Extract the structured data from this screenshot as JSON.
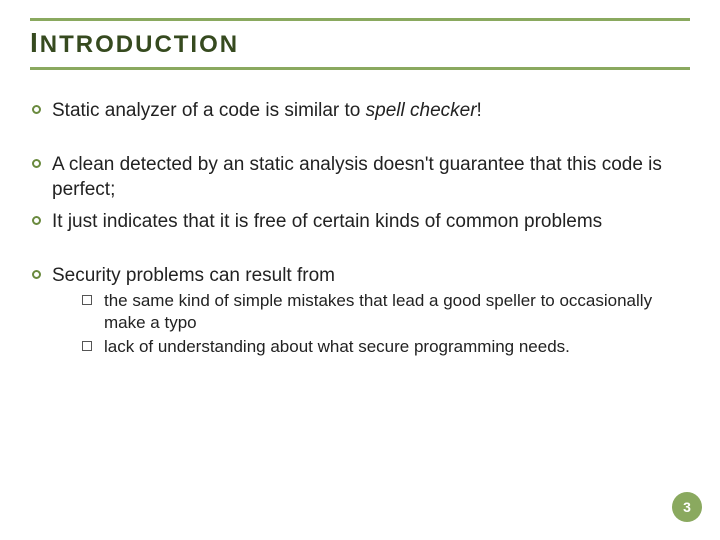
{
  "title_word": "NTRODUCTION",
  "title_cap": "I",
  "bullets": {
    "b1_pre": "Static analyzer of a code is similar to ",
    "b1_italic": "spell checker",
    "b1_post": "!",
    "b2": "A clean detected by an static analysis doesn't guarantee that this code is perfect;",
    "b3": "It just indicates that it is free of certain kinds of common problems",
    "b4": "Security problems can result from",
    "sub1": "the same kind of simple mistakes that lead a good speller to occasionally make a typo",
    "sub2": "lack of understanding about what secure programming needs."
  },
  "page_number": "3"
}
